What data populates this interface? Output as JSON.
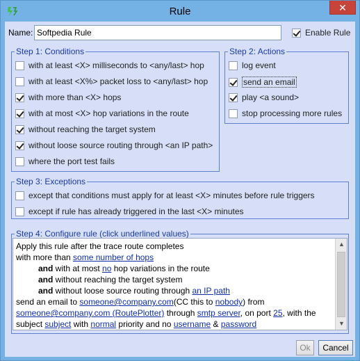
{
  "window": {
    "title": "Rule",
    "close_glyph": "✕",
    "icon": "app-logo-icon"
  },
  "header": {
    "name_label": "Name:",
    "name_value": "Softpedia Rule",
    "enable_label": "Enable Rule",
    "enable_checked": true
  },
  "conditions": {
    "title": "Step 1: Conditions",
    "items": [
      {
        "label": "with at least <X> milliseconds to <any/last> hop",
        "checked": false
      },
      {
        "label": "with at least <X%> packet loss to <any/last> hop",
        "checked": false
      },
      {
        "label": "with more than <X> hops",
        "checked": true
      },
      {
        "label": "with at most <X> hop variations in the route",
        "checked": true
      },
      {
        "label": "without reaching the target system",
        "checked": true
      },
      {
        "label": "without loose source routing through <an IP path>",
        "checked": true
      },
      {
        "label": "where the port test fails",
        "checked": false
      }
    ]
  },
  "actions": {
    "title": "Step 2: Actions",
    "items": [
      {
        "label": "log event",
        "checked": false
      },
      {
        "label": "send an email",
        "checked": true
      },
      {
        "label": "play <a sound>",
        "checked": true
      },
      {
        "label": "stop processing more rules",
        "checked": false
      }
    ]
  },
  "exceptions": {
    "title": "Step 3: Exceptions",
    "items": [
      {
        "label": "except that conditions must apply for at least <X> minutes before rule triggers",
        "checked": false
      },
      {
        "label": "except if rule has already triggered in the last <X> minutes",
        "checked": false
      }
    ]
  },
  "configure": {
    "title": "Step 4: Configure rule (click underlined values)",
    "l1": "Apply this rule after the trace route completes",
    "l2_pre": "with more than ",
    "l2_link": "some number of hops",
    "and": "and",
    "l3_pre": " with at most ",
    "l3_link": "no",
    "l3_post": " hop variations in the route",
    "l4": " without reaching the target system",
    "l5_pre": " without loose source routing through ",
    "l5_link": "an IP path",
    "l6_pre": "send an email to ",
    "l6_link1": "someone@company.com",
    "l6_mid": "(CC this to ",
    "l6_link2": "nobody",
    "l6_post": ") from",
    "l7_link1": "someone@company.com (RoutePlotter)",
    "l7_mid1": " through ",
    "l7_link2": "smtp server",
    "l7_mid2": ", on port ",
    "l7_link3": "25",
    "l7_post": ", with the",
    "l8_pre": "subject ",
    "l8_link1": "subject",
    "l8_mid1": " with ",
    "l8_link2": "normal",
    "l8_mid2": " priority and no ",
    "l8_link3": "username",
    "l8_mid3": " & ",
    "l8_link4": "password"
  },
  "buttons": {
    "ok": "Ok",
    "cancel": "Cancel"
  }
}
